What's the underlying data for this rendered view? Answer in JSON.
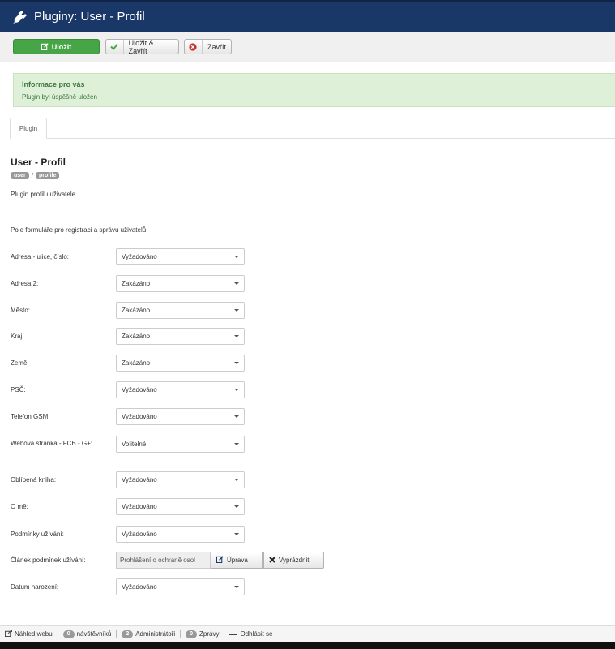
{
  "header": {
    "title": "Pluginy: User - Profil",
    "icon": "plug-icon"
  },
  "toolbar": {
    "save_label": "Uložit",
    "save_close_label": "Uložit & Zavřít",
    "close_label": "Zavřít"
  },
  "alert": {
    "heading": "Informace pro vás",
    "message": "Plugin byl úspěšně uložen"
  },
  "tabs": [
    {
      "label": "Plugin"
    }
  ],
  "plugin": {
    "title": "User - Profil",
    "badge_type": "user",
    "badge_separator": "/",
    "badge_element": "profile",
    "description": "Plugin profilu uživatele."
  },
  "form": {
    "section_label": "Pole formuláře pro registraci a správu uživatelů",
    "fields": [
      {
        "label": "Adresa - ulice, číslo:",
        "value": "Vyžadováno"
      },
      {
        "label": "Adresa 2:",
        "value": "Zakázáno"
      },
      {
        "label": "Město:",
        "value": "Zakázáno"
      },
      {
        "label": "Kraj:",
        "value": "Zakázáno"
      },
      {
        "label": "Země:",
        "value": "Zakázáno"
      },
      {
        "label": "PSČ:",
        "value": "Vyžadováno"
      },
      {
        "label": "Telefon GSM:",
        "value": "Vyžadováno"
      },
      {
        "label": "Webová stránka - FCB - G+:",
        "value": "Volitelné"
      },
      {
        "label": "Oblíbená kniha:",
        "value": "Vyžadováno"
      },
      {
        "label": "O mě:",
        "value": "Vyžadováno"
      },
      {
        "label": "Podmínky užívání:",
        "value": "Vyžadováno"
      }
    ],
    "article": {
      "label": "Článek podmínek užívání:",
      "value": "Prohlášení o ochraně osol",
      "edit_label": "Úprava",
      "clear_label": "Vyprázdnit"
    },
    "birthdate": {
      "label": "Datum narození:",
      "value": "Vyžadováno"
    }
  },
  "footer": {
    "view_site": "Náhled webu",
    "visitors_count": "0",
    "visitors_label": "návštěvníků",
    "admins_count": "2",
    "admins_label": "Administrátoři",
    "messages_count": "0",
    "messages_label": "Zprávy",
    "logout_label": "Odhlásit se"
  },
  "colors": {
    "header_bg": "#1a3867",
    "save_green": "#46a546",
    "alert_bg": "#dff0d8",
    "alert_text": "#3c763d"
  }
}
